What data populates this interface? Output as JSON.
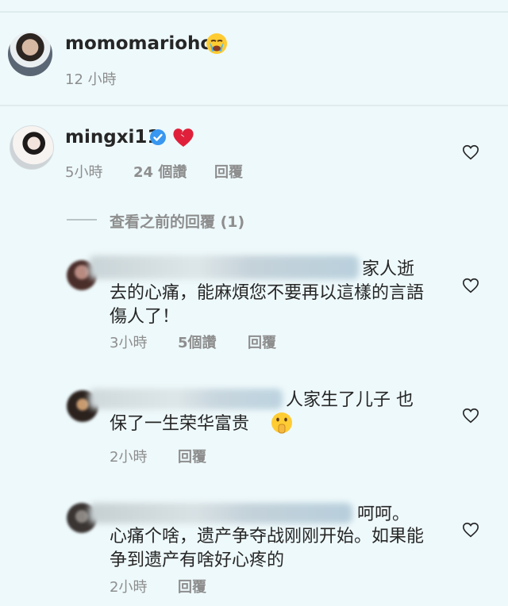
{
  "comment1": {
    "username": "momomarioho",
    "time": "12 小時"
  },
  "comment2": {
    "username": "mingxi11",
    "time": "5小時",
    "likes": "24 個讚",
    "reply": "回覆"
  },
  "view_previous": "查看之前的回覆 (1)",
  "replies": [
    {
      "text_line1": "家人逝",
      "text_rest": "去的心痛，能麻煩您不要再以這樣的言語傷人了！",
      "time": "3小時",
      "likes": "5個讚",
      "reply": "回覆"
    },
    {
      "text_line1": "人家生了儿子 也",
      "text_rest": "保了一生荣华富贵",
      "time": "2小時",
      "reply": "回覆"
    },
    {
      "text_line1": "呵呵。",
      "text_rest": "心痛个啥，遗产争夺战刚刚开始。如果能争到遗产有啥好心疼的",
      "time": "2小時",
      "reply": "回覆"
    }
  ],
  "colors": {
    "background": "#eef9fb",
    "meta": "#8e8e8e",
    "heart_stroke": "#262626",
    "broken_heart": "#e0203a",
    "verified": "#3897f0"
  },
  "icons": [
    "crying-face-emoji",
    "verified-badge-icon",
    "broken-heart-emoji",
    "heart-icon",
    "shushing-face-emoji"
  ]
}
